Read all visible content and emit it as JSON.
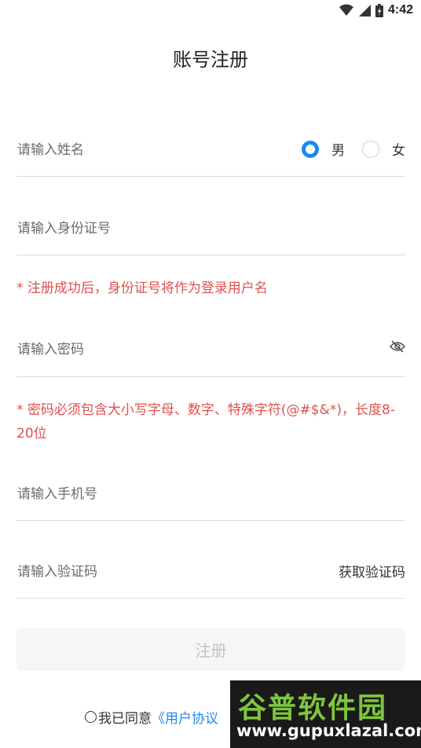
{
  "status": {
    "time": "4:42"
  },
  "header": {
    "title": "账号注册"
  },
  "form": {
    "name_placeholder": "请输入姓名",
    "gender_male": "男",
    "gender_female": "女",
    "selected_gender": "男",
    "id_placeholder": "请输入身份证号",
    "id_hint": "* 注册成功后，身份证号将作为登录用户名",
    "password_placeholder": "请输入密码",
    "password_hint": "* 密码必须包含大小写字母、数字、特殊字符(@#$&*)，长度8-20位",
    "phone_placeholder": "请输入手机号",
    "code_placeholder": "请输入验证码",
    "get_code_label": "获取验证码",
    "submit_label": "注册"
  },
  "agreement": {
    "prefix": "我已同意",
    "link": "《用户协议"
  },
  "watermark": {
    "brand": "谷普软件园",
    "url": "www.gupuxlazal.com"
  },
  "colors": {
    "accent": "#1e88f0",
    "hint": "#e05050"
  }
}
